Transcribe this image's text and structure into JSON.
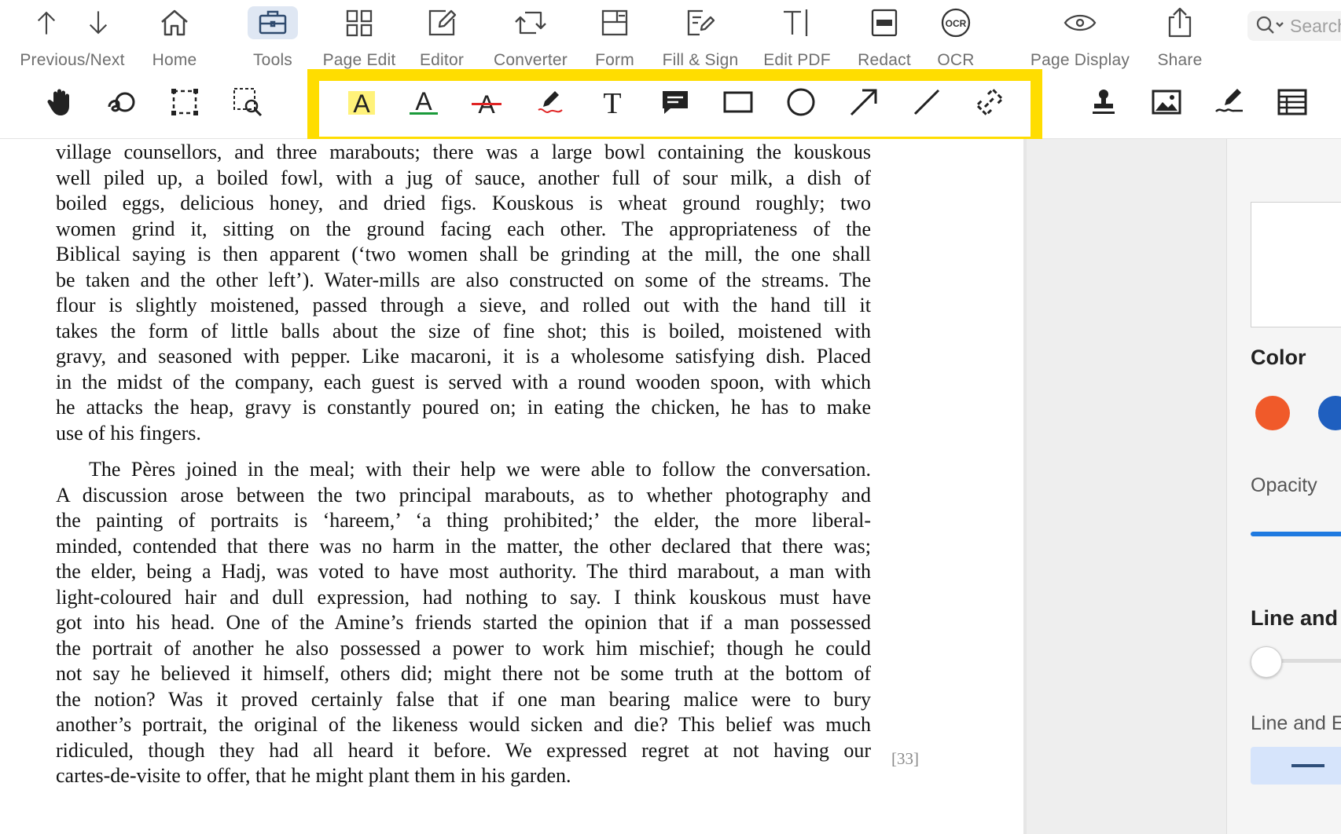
{
  "toolbar": {
    "items": [
      {
        "label": "Previous/Next",
        "icon": "arrows-up-down-icon"
      },
      {
        "label": "Home",
        "icon": "home-icon"
      },
      {
        "label": "Tools",
        "icon": "toolbox-icon",
        "active": true
      },
      {
        "label": "Page Edit",
        "icon": "grid-icon"
      },
      {
        "label": "Editor",
        "icon": "pencil-square-icon"
      },
      {
        "label": "Converter",
        "icon": "convert-icon"
      },
      {
        "label": "Form",
        "icon": "form-icon"
      },
      {
        "label": "Fill & Sign",
        "icon": "fill-sign-icon"
      },
      {
        "label": "Edit PDF",
        "icon": "text-cursor-icon"
      },
      {
        "label": "Redact",
        "icon": "redact-icon"
      },
      {
        "label": "OCR",
        "icon": "ocr-icon"
      },
      {
        "label": "Page Display",
        "icon": "eye-icon"
      },
      {
        "label": "Share",
        "icon": "share-icon"
      }
    ],
    "search_placeholder": "Search",
    "ocr_badge": "OCR"
  },
  "subtoolbar": {
    "icons": [
      "hand-icon",
      "text-select-icon",
      "marquee-select-icon",
      "area-zoom-icon",
      "highlight-icon",
      "underline-icon",
      "strikethrough-icon",
      "freehand-pen-icon",
      "text-box-icon",
      "comment-note-icon",
      "rectangle-icon",
      "ellipse-icon",
      "arrow-icon",
      "line-icon",
      "link-icon",
      "stamp-icon",
      "image-icon",
      "signature-icon",
      "table-icon"
    ],
    "glyphs": {
      "highlight": "A",
      "underline": "A",
      "strike": "A",
      "text": "T"
    },
    "colors": {
      "highlight": "#fff27a",
      "underline": "#1a9a3a",
      "strike": "#e02424",
      "pen_stroke": "#e02424",
      "annotation_frame": "#ffdd00"
    }
  },
  "document": {
    "para1_lines": [
      "village counsellors, and three marabouts; there was a large bowl containing the kouskous",
      "well piled up, a boiled fowl, with a jug of sauce, another full of sour milk, a dish of",
      "boiled eggs, delicious honey, and dried figs. Kouskous is wheat ground roughly; two",
      "women grind it, sitting on the ground facing each other. The appropriateness of the",
      "Biblical saying is then apparent (‘two women shall be grinding at the mill, the one shall",
      "be taken and the other left’). Water-mills are also constructed on some of the streams. The",
      "flour is slightly moistened, passed through a sieve, and rolled out with the hand till it",
      "takes the form of little balls about the size of fine shot; this is boiled, moistened with",
      "gravy, and seasoned with pepper. Like macaroni, it is a wholesome satisfying dish. Placed",
      "in the midst of the company, each guest is served with a round wooden spoon, with which",
      "he attacks the heap, gravy is constantly poured on; in eating the chicken, he has to make",
      "use of his fingers."
    ],
    "para2_lines": [
      "The Pères joined in the meal; with their help we were able to follow the conversation.",
      "A discussion arose between the two principal marabouts, as to whether photography and",
      "the painting of portraits is ‘hareem,’ ‘a thing prohibited;’ the elder, the more liberal-",
      "minded, contended that there was no harm in the matter, the other declared that there was;",
      "the elder, being a Hadj, was voted to have most authority. The third marabout, a man with",
      "light-coloured hair and dull expression, had nothing to say. I think kouskous must have",
      "got into his head. One of the Amine’s friends started the opinion that if a man possessed",
      "the portrait of another he also possessed a power to work him mischief; though he could",
      "not say he believed it himself, others did; might there not be some truth at the bottom of",
      "the notion? Was it proved certainly false that if one man bearing malice were to bury",
      "another’s portrait, the original of the likeness would sicken and die? This belief was much",
      "ridiculed, though they had all heard it before. We expressed regret at not having our",
      "cartes-de-visite to offer, that he might plant them in his garden."
    ],
    "page_number": "[33]"
  },
  "sidebar": {
    "color_title": "Color",
    "colors": [
      "#f05a2a",
      "#1f5fbf"
    ],
    "opacity_label": "Opacity",
    "opacity_value": 1.0,
    "line_title": "Line and",
    "line_label": "Line and E",
    "line_width_value": 0.0
  }
}
